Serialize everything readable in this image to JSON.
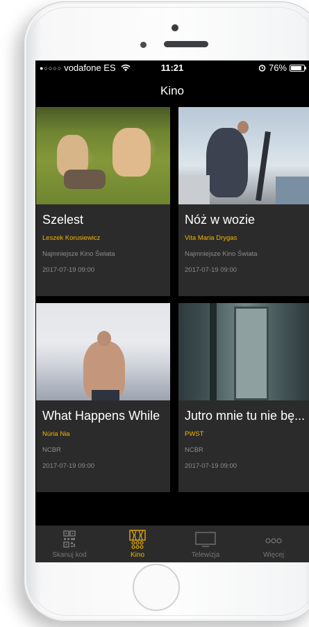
{
  "status_bar": {
    "signal": "●○○○○",
    "carrier": "vodafone ES",
    "time": "11:21",
    "battery": "76%"
  },
  "header": {
    "title": "Kino"
  },
  "films": [
    {
      "title": "Szelest",
      "director": "Leszek Korusiewicz",
      "venue": "Najmniejsze Kino Świata",
      "date": "2017-07-19 09:00"
    },
    {
      "title": "Nóż w wozie",
      "director": "Vita Maria Drygas",
      "venue": "Najmniejsze Kino Świata",
      "date": "2017-07-19 09:00"
    },
    {
      "title": "What Happens While",
      "director": "Núria Nia",
      "venue": "NCBR",
      "date": "2017-07-19 09:00"
    },
    {
      "title": "Jutro mnie tu nie bę...",
      "director": "PWST",
      "venue": "NCBR",
      "date": "2017-07-19 09:00"
    }
  ],
  "tabs": [
    {
      "label": "Skanuj kod",
      "icon": "qr-code-icon",
      "active": false
    },
    {
      "label": "Kino",
      "icon": "film-icon",
      "active": true
    },
    {
      "label": "Telewizja",
      "icon": "tv-icon",
      "active": false
    },
    {
      "label": "Więcej",
      "icon": "more-icon",
      "active": false
    }
  ],
  "colors": {
    "accent": "#f5b400",
    "card_background": "#2b2b2b",
    "screen_background": "#000000",
    "inactive": "#777777"
  }
}
